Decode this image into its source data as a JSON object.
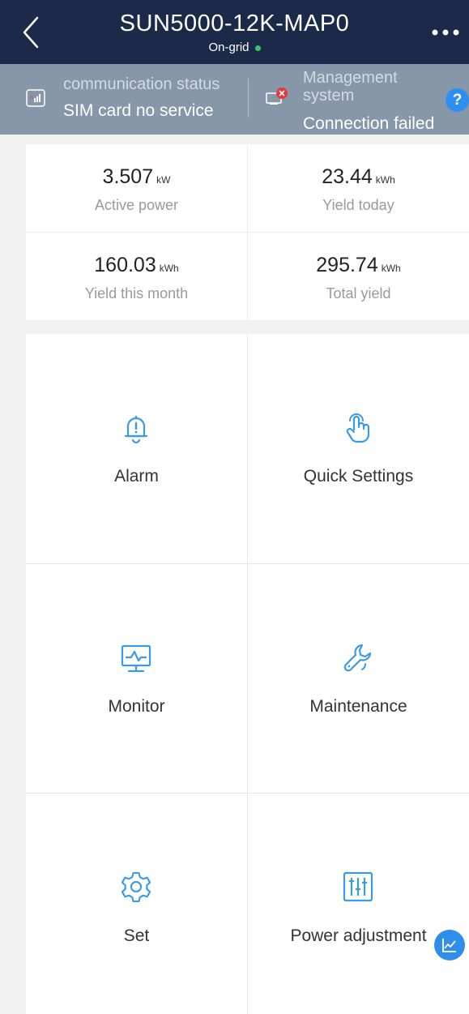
{
  "header": {
    "title": "SUN5000-12K-MAP0",
    "status": "On-grid",
    "status_dot_color": "#39c46a",
    "back_icon": "chevron-left-icon",
    "more_icon": "more-horizontal-icon"
  },
  "status_bar": {
    "communication": {
      "label": "communication status",
      "value": "SIM card no service"
    },
    "management": {
      "label_line1": "Management",
      "label_line2": "system",
      "value": "Connection failed"
    },
    "help": "?"
  },
  "stats": [
    {
      "value": "3.507",
      "unit": "kW",
      "label": "Active power"
    },
    {
      "value": "23.44",
      "unit": "kWh",
      "label": "Yield today"
    },
    {
      "value": "160.03",
      "unit": "kWh",
      "label": "Yield this month"
    },
    {
      "value": "295.74",
      "unit": "kWh",
      "label": "Total yield"
    }
  ],
  "menu": [
    {
      "label": "Alarm",
      "icon": "bell-alert-icon"
    },
    {
      "label": "Quick Settings",
      "icon": "hand-tap-icon"
    },
    {
      "label": "Monitor",
      "icon": "monitor-chart-icon"
    },
    {
      "label": "Maintenance",
      "icon": "wrench-icon"
    },
    {
      "label": "Set",
      "icon": "gear-icon"
    },
    {
      "label": "Power adjustment",
      "icon": "sliders-icon"
    }
  ],
  "colors": {
    "header_bg": "#1b2a48",
    "status_bg": "#8797aa",
    "accent": "#2e8ff0",
    "icon": "#3a9ae6"
  }
}
